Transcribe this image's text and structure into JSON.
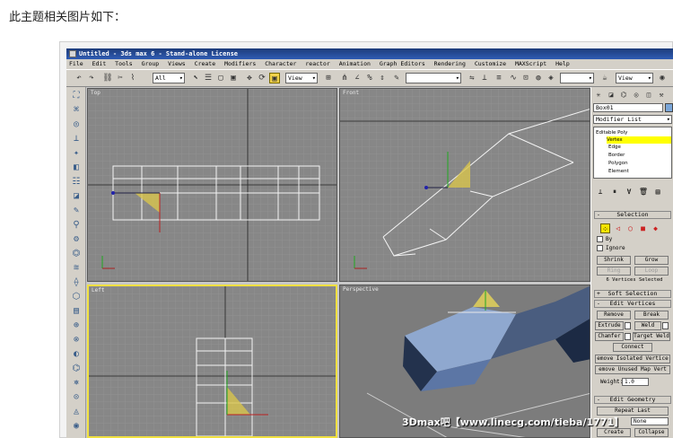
{
  "caption": "此主题相关图片如下：",
  "window": {
    "title": "Untitled - 3ds max 6 - Stand-alone License"
  },
  "menu": [
    "File",
    "Edit",
    "Tools",
    "Group",
    "Views",
    "Create",
    "Modifiers",
    "Character",
    "reactor",
    "Animation",
    "Graph Editors",
    "Rendering",
    "Customize",
    "MAXScript",
    "Help"
  ],
  "toolbar": {
    "filter_value": "All",
    "coord_value": "View",
    "view_value": "View"
  },
  "viewports": {
    "top": "Top",
    "front": "Front",
    "left": "Left",
    "perspective": "Perspective"
  },
  "command_panel": {
    "object_name": "Box01",
    "modifier_list": "Modifier List",
    "stack": {
      "base": "Editable Poly",
      "items": [
        "Vertex",
        "Edge",
        "Border",
        "Polygon",
        "Element"
      ]
    },
    "selection": {
      "title": "Selection",
      "by": "By",
      "ignore": "Ignore",
      "shrink": "Shrink",
      "grow": "Grow",
      "ring": "Ring",
      "loop": "Loop",
      "status": "6 Vertices Selected"
    },
    "soft_selection": "Soft Selection",
    "edit_vertices": {
      "title": "Edit Vertices",
      "remove": "Remove",
      "break": "Break",
      "extrude": "Extrude",
      "weld": "Weld",
      "chamfer": "Chamfer",
      "target_weld": "Target Weld",
      "connect": "Connect",
      "remove_isolated": "emove Isolated Vertice",
      "remove_unused": "emove Unused Map Vert",
      "weight_label": "Weight:",
      "weight_value": "1.0"
    },
    "edit_geometry": {
      "title": "Edit Geometry",
      "repeat_last": "Repeat Last",
      "constraint_value": "None",
      "create": "Create",
      "collapse": "Collapse"
    }
  },
  "watermark": "3Dmax吧【www.linecg.com/tieba/1771】"
}
